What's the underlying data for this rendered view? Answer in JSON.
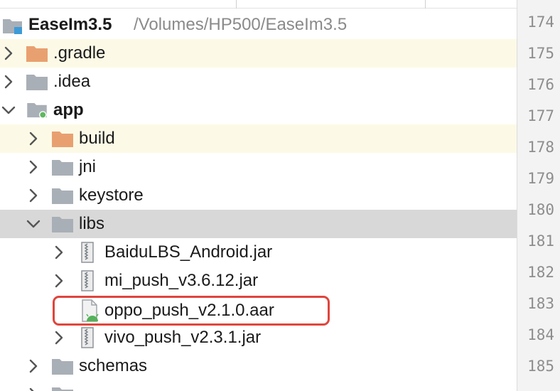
{
  "project": {
    "name": "EaseIm3.5",
    "path": "/Volumes/HP500/EaseIm3.5"
  },
  "tree_items": [
    {
      "id": "gradle",
      "label": ".gradle",
      "expanded": false,
      "highlight": true,
      "icon": "folder-orange-icon"
    },
    {
      "id": "idea",
      "label": ".idea",
      "expanded": false,
      "icon": "folder-gray-icon"
    },
    {
      "id": "app",
      "label": "app",
      "expanded": true,
      "bold": true,
      "icon": "module-folder-icon"
    },
    {
      "id": "build",
      "label": "build",
      "expanded": false,
      "highlight": true,
      "icon": "folder-orange-icon"
    },
    {
      "id": "jni",
      "label": "jni",
      "expanded": false,
      "icon": "folder-gray-icon"
    },
    {
      "id": "keystore",
      "label": "keystore",
      "expanded": false,
      "icon": "folder-gray-icon"
    },
    {
      "id": "libs",
      "label": "libs",
      "expanded": true,
      "selected": true,
      "icon": "folder-gray-icon"
    },
    {
      "id": "baidu",
      "label": "BaiduLBS_Android.jar",
      "expanded": false,
      "icon": "jar-icon"
    },
    {
      "id": "mipush",
      "label": "mi_push_v3.6.12.jar",
      "expanded": false,
      "icon": "jar-icon"
    },
    {
      "id": "oppo",
      "label": "oppo_push_v2.1.0.aar",
      "boxed": true,
      "icon": "aar-android-icon"
    },
    {
      "id": "vivo",
      "label": "vivo_push_v2.3.1.jar",
      "expanded": false,
      "icon": "jar-icon"
    },
    {
      "id": "schemas",
      "label": "schemas",
      "expanded": false,
      "icon": "folder-gray-icon"
    }
  ],
  "line_numbers": [
    "174",
    "175",
    "176",
    "177",
    "178",
    "179",
    "180",
    "181",
    "182",
    "183",
    "184",
    "185"
  ],
  "colors": {
    "highlight_row": "#fcfae6",
    "selected_row": "#d8d8d8",
    "annotation_box": "#e0453c",
    "folder_orange": "#e9a070",
    "folder_gray": "#a9afb6",
    "module_dot": "#5fb85f"
  }
}
